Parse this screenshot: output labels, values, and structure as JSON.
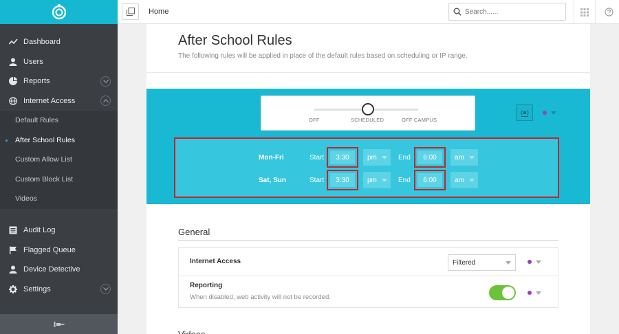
{
  "sidebar": {
    "items": [
      {
        "label": "Dashboard",
        "icon": "dashboard-icon"
      },
      {
        "label": "Users",
        "icon": "user-icon"
      },
      {
        "label": "Reports",
        "icon": "pie-chart-icon"
      },
      {
        "label": "Internet Access",
        "icon": "globe-icon"
      }
    ],
    "internet_access_sub": [
      {
        "label": "Default Rules"
      },
      {
        "label": "After School Rules"
      },
      {
        "label": "Custom Allow List"
      },
      {
        "label": "Custom Block List"
      },
      {
        "label": "Videos"
      }
    ],
    "items2": [
      {
        "label": "Audit Log",
        "icon": "list-icon"
      },
      {
        "label": "Flagged Queue",
        "icon": "flag-icon"
      },
      {
        "label": "Device Detective",
        "icon": "user-icon"
      },
      {
        "label": "Settings",
        "icon": "gear-icon"
      }
    ],
    "accent_color": "#16b7d0"
  },
  "topbar": {
    "breadcrumb": "Home",
    "search_placeholder": "Search......"
  },
  "page": {
    "title": "After School Rules",
    "subtitle": "The following rules will be applied in place of the default rules based on scheduling or IP range."
  },
  "mode_selector": {
    "options": [
      "OFF",
      "SCHEDULED",
      "OFF CAMPUS"
    ],
    "selected": "SCHEDULED"
  },
  "schedule": {
    "start_word": "Start",
    "end_word": "End",
    "rows": [
      {
        "label": "Mon-Fri",
        "start": "3:30",
        "start_ampm": "pm",
        "end": "6:00",
        "end_ampm": "am"
      },
      {
        "label": "Sat, Sun",
        "start": "3:30",
        "start_ampm": "pm",
        "end": "6:00",
        "end_ampm": "am"
      }
    ]
  },
  "general": {
    "title": "General",
    "internet_access": {
      "label": "Internet Access",
      "value": "Filtered"
    },
    "reporting": {
      "label": "Reporting",
      "description": "When disabled, web activity will not be recorded.",
      "enabled": true
    }
  },
  "next_section_title": "Videos",
  "colors": {
    "teal": "#19b9d3",
    "highlight_border": "#c0262d",
    "toggle_on": "#6cc33a",
    "dot": "#9b3fbf"
  }
}
